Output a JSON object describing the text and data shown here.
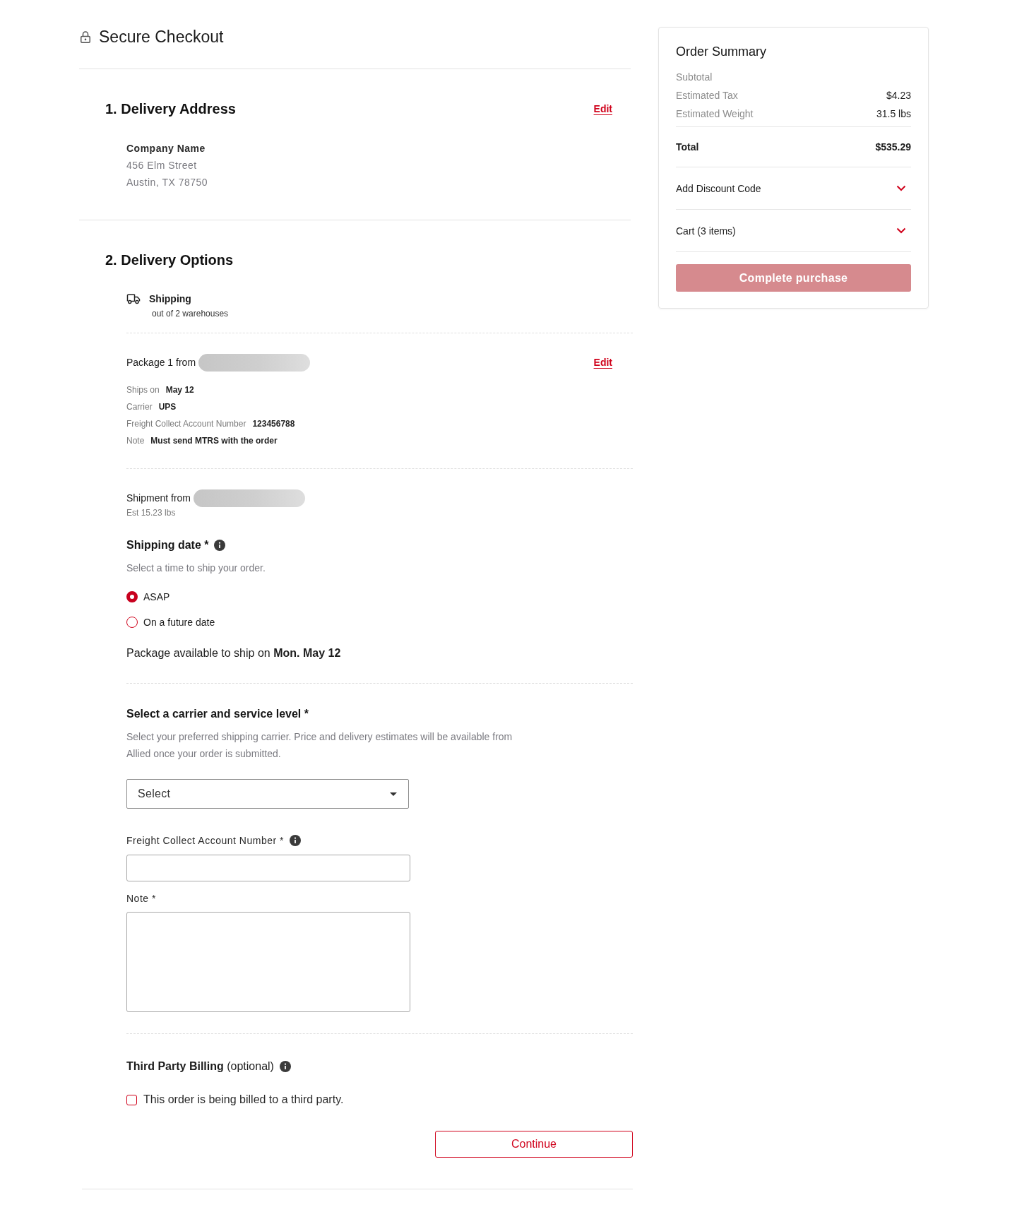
{
  "header": {
    "title": "Secure Checkout"
  },
  "delivery_address": {
    "heading": "1. Delivery Address",
    "edit_link": "Edit",
    "company": "Company Name",
    "lines": [
      "456 Elm Street",
      "Austin, TX 78750"
    ]
  },
  "delivery_options": {
    "heading": "2. Delivery Options",
    "method": {
      "label": "Shipping",
      "note": "out of 2 warehouses"
    },
    "package": {
      "label": "Package 1 from",
      "edit_link": "Edit",
      "details": [
        {
          "label": "Ships on",
          "value": "May 12"
        },
        {
          "label": "Carrier",
          "value": "UPS"
        },
        {
          "label": "Freight Collect Account Number",
          "value": "123456788"
        },
        {
          "label": "Note",
          "value": "Must send MTRS with the order"
        }
      ]
    },
    "shipment": {
      "label": "Shipment from",
      "weight": "Est 15.23 lbs"
    },
    "shipping_date": {
      "label": "Shipping date *",
      "hint": "Select a time to ship your order.",
      "options": [
        {
          "label": "ASAP",
          "selected": true
        },
        {
          "label": "On a future date",
          "selected": false
        }
      ],
      "availability": "Package available to ship on **Mon. May 12**"
    },
    "carrier": {
      "label": "Select a carrier and service level *",
      "description": "Select your preferred shipping carrier. Price and delivery estimates will be available from Allied once your order is submitted.",
      "select": {
        "placeholder": "Select"
      }
    },
    "account_number": {
      "label": "Freight Collect Account Number *"
    },
    "note": {
      "label": "Note *"
    },
    "third_party": {
      "label": "**Third Party Billing** (optional)",
      "checkbox": {
        "label": "This order is being billed to a third party.",
        "checked": false
      }
    },
    "continue_button": "Continue"
  },
  "order_summary": {
    "title": "Order Summary",
    "rows": [
      {
        "label": "Subtotal"
      },
      {
        "label": "Estimated Tax",
        "value": "$4.23"
      },
      {
        "label": "Estimated Weight",
        "value": "31.5 lbs"
      }
    ],
    "total": {
      "label": "Total",
      "value": "$535.29"
    },
    "accordions": [
      {
        "label": "Add Discount Code",
        "expanded": false
      },
      {
        "label": "Cart (3 items)",
        "expanded": false
      }
    ],
    "button": {
      "label": "Complete purchase",
      "disabled": true
    }
  }
}
